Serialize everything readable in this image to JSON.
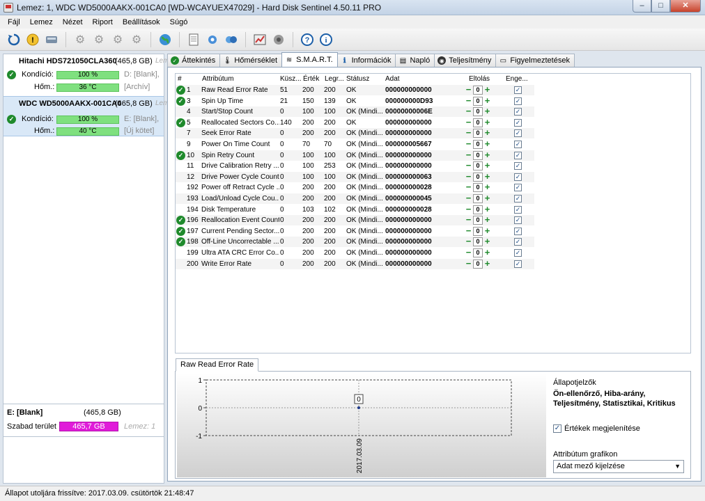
{
  "window": {
    "title": "Lemez: 1, WDC WD5000AAKX-001CA0 [WD-WCAYUEX47029]  -  Hard Disk Sentinel 4.50.11 PRO",
    "min": "–",
    "max": "□",
    "close": "✕"
  },
  "menu": [
    "Fájl",
    "Lemez",
    "Nézet",
    "Riport",
    "Beállítások",
    "Súgó"
  ],
  "toolbar": {
    "icons": [
      "refresh-icon",
      "warning-icon",
      "disk-icon",
      "drive-gray-icon",
      "drive-gray-icon-2",
      "drive-gray-icon-3",
      "drive-gray-icon-4",
      "globe-icon",
      "document-icon",
      "settings-icon",
      "network-icon",
      "report-icon",
      "speaker-icon",
      "help-icon",
      "info-icon"
    ]
  },
  "disks": [
    {
      "name": "Hitachi HDS721050CLA360",
      "size": "(465,8 GB)",
      "extra": "Leme",
      "condition_label": "Kondíció:",
      "condition": "100 %",
      "condition_level": 1.0,
      "temp_label": "Hőm.:",
      "temp": "36 °C",
      "vol": "D: [Blank],",
      "vol2": "[Archív]"
    },
    {
      "name": "WDC WD5000AAKX-001CA0",
      "size": "(465,8 GB)",
      "extra": "Lem",
      "condition_label": "Kondíció:",
      "condition": "100 %",
      "condition_level": 1.0,
      "temp_label": "Hőm.:",
      "temp": "40 °C",
      "vol": "E: [Blank],",
      "vol2": "[Új kötet]"
    }
  ],
  "volume": {
    "name": "E: [Blank]",
    "size": "(465,8 GB)",
    "free_label": "Szabad terület",
    "free": "465,7 GB",
    "extra": "Lemez: 1"
  },
  "tabs": [
    {
      "label": "Áttekintés",
      "icon": "check-icon"
    },
    {
      "label": "Hőmérséklet",
      "icon": "thermometer-icon"
    },
    {
      "label": "S.M.A.R.T.",
      "icon": "smart-icon"
    },
    {
      "label": "Információk",
      "icon": "info-icon"
    },
    {
      "label": "Napló",
      "icon": "log-icon"
    },
    {
      "label": "Teljesítmény",
      "icon": "performance-icon"
    },
    {
      "label": "Figyelmeztetések",
      "icon": "alerts-icon"
    }
  ],
  "table": {
    "headers": [
      "#",
      "Attribútum",
      "Küsz...",
      "Érték",
      "Legr...",
      "Státusz",
      "Adat",
      "Eltolás",
      "Enge..."
    ],
    "rows": [
      {
        "ok": true,
        "id": "1",
        "attr": "Raw Read Error Rate",
        "thr": "51",
        "val": "200",
        "worst": "200",
        "status": "OK",
        "data": "000000000000",
        "offset": "0"
      },
      {
        "ok": true,
        "id": "3",
        "attr": "Spin Up Time",
        "thr": "21",
        "val": "150",
        "worst": "139",
        "status": "OK",
        "data": "000000000D93",
        "offset": "0"
      },
      {
        "ok": false,
        "id": "4",
        "attr": "Start/Stop Count",
        "thr": "0",
        "val": "100",
        "worst": "100",
        "status": "OK (Mindi...",
        "data": "00000000006E",
        "offset": "0"
      },
      {
        "ok": true,
        "id": "5",
        "attr": "Reallocated Sectors Co...",
        "thr": "140",
        "val": "200",
        "worst": "200",
        "status": "OK",
        "data": "000000000000",
        "offset": "0"
      },
      {
        "ok": false,
        "id": "7",
        "attr": "Seek Error Rate",
        "thr": "0",
        "val": "200",
        "worst": "200",
        "status": "OK (Mindi...",
        "data": "000000000000",
        "offset": "0"
      },
      {
        "ok": false,
        "id": "9",
        "attr": "Power On Time Count",
        "thr": "0",
        "val": "70",
        "worst": "70",
        "status": "OK (Mindi...",
        "data": "000000005667",
        "offset": "0"
      },
      {
        "ok": true,
        "id": "10",
        "attr": "Spin Retry Count",
        "thr": "0",
        "val": "100",
        "worst": "100",
        "status": "OK (Mindi...",
        "data": "000000000000",
        "offset": "0"
      },
      {
        "ok": false,
        "id": "11",
        "attr": "Drive Calibration Retry ...",
        "thr": "0",
        "val": "100",
        "worst": "253",
        "status": "OK (Mindi...",
        "data": "000000000000",
        "offset": "0"
      },
      {
        "ok": false,
        "id": "12",
        "attr": "Drive Power Cycle Count",
        "thr": "0",
        "val": "100",
        "worst": "100",
        "status": "OK (Mindi...",
        "data": "000000000063",
        "offset": "0"
      },
      {
        "ok": false,
        "id": "192",
        "attr": "Power off Retract Cycle ...",
        "thr": "0",
        "val": "200",
        "worst": "200",
        "status": "OK (Mindi...",
        "data": "000000000028",
        "offset": "0"
      },
      {
        "ok": false,
        "id": "193",
        "attr": "Load/Unload Cycle Cou...",
        "thr": "0",
        "val": "200",
        "worst": "200",
        "status": "OK (Mindi...",
        "data": "000000000045",
        "offset": "0"
      },
      {
        "ok": false,
        "id": "194",
        "attr": "Disk Temperature",
        "thr": "0",
        "val": "103",
        "worst": "102",
        "status": "OK (Mindi...",
        "data": "000000000028",
        "offset": "0"
      },
      {
        "ok": true,
        "id": "196",
        "attr": "Reallocation Event Count",
        "thr": "0",
        "val": "200",
        "worst": "200",
        "status": "OK (Mindi...",
        "data": "000000000000",
        "offset": "0"
      },
      {
        "ok": true,
        "id": "197",
        "attr": "Current Pending Sector...",
        "thr": "0",
        "val": "200",
        "worst": "200",
        "status": "OK (Mindi...",
        "data": "000000000000",
        "offset": "0"
      },
      {
        "ok": true,
        "id": "198",
        "attr": "Off-Line Uncorrectable ...",
        "thr": "0",
        "val": "200",
        "worst": "200",
        "status": "OK (Mindi...",
        "data": "000000000000",
        "offset": "0"
      },
      {
        "ok": false,
        "id": "199",
        "attr": "Ultra ATA CRC Error Co...",
        "thr": "0",
        "val": "200",
        "worst": "200",
        "status": "OK (Mindi...",
        "data": "000000000000",
        "offset": "0"
      },
      {
        "ok": false,
        "id": "200",
        "attr": "Write Error Rate",
        "thr": "0",
        "val": "200",
        "worst": "200",
        "status": "OK (Mindi...",
        "data": "000000000000",
        "offset": "0"
      }
    ]
  },
  "chart_tab": "Raw Read Error Rate",
  "chart_data": {
    "type": "line",
    "x": [
      "2017.03.09"
    ],
    "series": [
      {
        "values": [
          0
        ]
      }
    ],
    "ylim": [
      -1,
      1
    ],
    "yticks": [
      "1",
      "0",
      "-1"
    ],
    "data_labels": [
      "0"
    ]
  },
  "right_panel": {
    "indicators_title": "Állapotjelzők",
    "indicators": "Ön-ellenőrző, Hiba-arány, Teljesítmény, Statisztikai, Kritikus",
    "show_values_label": "Értékek megjelenítése",
    "show_values": true,
    "graph_label": "Attribútum grafikon",
    "graph_select": "Adat mező kijelzése"
  },
  "status": "Állapot utoljára frissítve: 2017.03.09. csütörtök 21:48:47",
  "colors": {
    "ok_green": "#1f8a2c",
    "bar_green": "#7fe07f",
    "free_magenta": "#e01bd9"
  }
}
